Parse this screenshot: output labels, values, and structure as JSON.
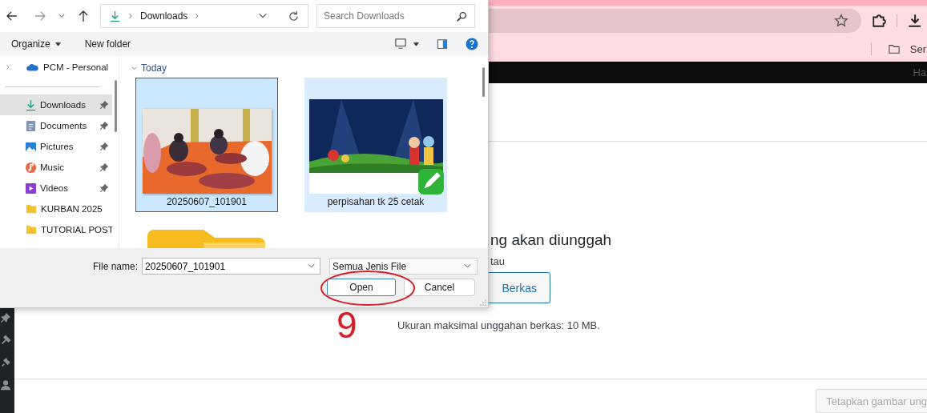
{
  "browser": {
    "bookmark_folder": "Ser",
    "admin_bar_link": "Ha"
  },
  "page": {
    "heading": "ng akan diunggah",
    "or_text": "tau",
    "select_button": "Berkas",
    "max_size_note": "Ukuran maksimal unggahan berkas: 10 MB.",
    "set_image_button": {
      "label": "Tetapkan gambar ung",
      "disabled": true
    }
  },
  "annotation": {
    "step_number": "9"
  },
  "dialog": {
    "breadcrumb": [
      "Downloads"
    ],
    "search": {
      "placeholder": "Search Downloads"
    },
    "commands": [
      "Organize",
      "New folder"
    ],
    "cloud_root": {
      "label": "PCM - Personal",
      "expanded": false
    },
    "quick_access": [
      {
        "label": "Downloads",
        "kind": "downloads",
        "pinned": true,
        "selected": true
      },
      {
        "label": "Documents",
        "kind": "documents",
        "pinned": true,
        "selected": false
      },
      {
        "label": "Pictures",
        "kind": "pictures",
        "pinned": true,
        "selected": false
      },
      {
        "label": "Music",
        "kind": "music",
        "pinned": true,
        "selected": false
      },
      {
        "label": "Videos",
        "kind": "videos",
        "pinned": true,
        "selected": false
      },
      {
        "label": "KURBAN 2025",
        "kind": "folder",
        "pinned": false,
        "selected": false
      },
      {
        "label": "TUTORIAL POST",
        "kind": "folder",
        "pinned": false,
        "selected": false
      }
    ],
    "group": {
      "label": "Today",
      "expanded": true
    },
    "files": [
      {
        "name": "20250607_101901",
        "selected": true,
        "hovered": false
      },
      {
        "name": "perpisahan tk 25 cetak",
        "kind": "banner",
        "selected": false,
        "hovered": true
      },
      {
        "kind": "folder",
        "selected": false,
        "hovered": false
      }
    ],
    "file_name": {
      "label": "File name:",
      "value": "20250607_101901"
    },
    "file_type": "Semua Jenis File",
    "buttons": [
      {
        "label": "Open",
        "default": true
      },
      {
        "label": "Cancel",
        "default": false
      }
    ]
  }
}
